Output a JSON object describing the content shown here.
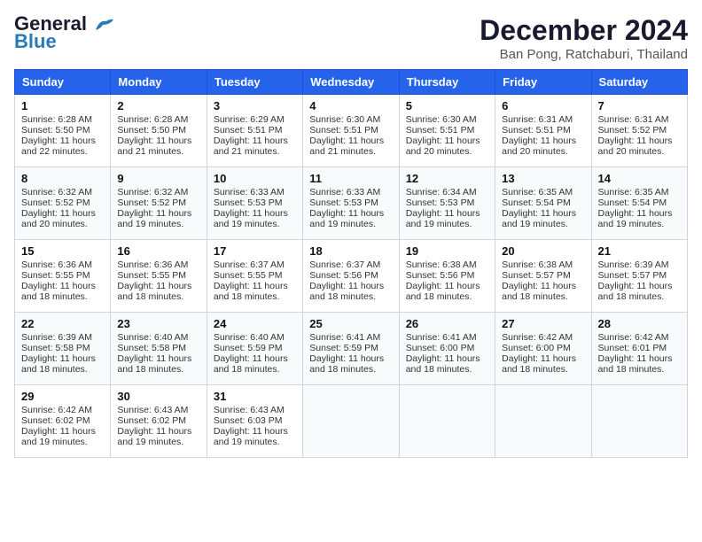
{
  "logo": {
    "line1": "General",
    "line2": "Blue"
  },
  "title": "December 2024",
  "subtitle": "Ban Pong, Ratchaburi, Thailand",
  "weekdays": [
    "Sunday",
    "Monday",
    "Tuesday",
    "Wednesday",
    "Thursday",
    "Friday",
    "Saturday"
  ],
  "weeks": [
    [
      {
        "day": 1,
        "lines": [
          "Sunrise: 6:28 AM",
          "Sunset: 5:50 PM",
          "Daylight: 11 hours",
          "and 22 minutes."
        ]
      },
      {
        "day": 2,
        "lines": [
          "Sunrise: 6:28 AM",
          "Sunset: 5:50 PM",
          "Daylight: 11 hours",
          "and 21 minutes."
        ]
      },
      {
        "day": 3,
        "lines": [
          "Sunrise: 6:29 AM",
          "Sunset: 5:51 PM",
          "Daylight: 11 hours",
          "and 21 minutes."
        ]
      },
      {
        "day": 4,
        "lines": [
          "Sunrise: 6:30 AM",
          "Sunset: 5:51 PM",
          "Daylight: 11 hours",
          "and 21 minutes."
        ]
      },
      {
        "day": 5,
        "lines": [
          "Sunrise: 6:30 AM",
          "Sunset: 5:51 PM",
          "Daylight: 11 hours",
          "and 20 minutes."
        ]
      },
      {
        "day": 6,
        "lines": [
          "Sunrise: 6:31 AM",
          "Sunset: 5:51 PM",
          "Daylight: 11 hours",
          "and 20 minutes."
        ]
      },
      {
        "day": 7,
        "lines": [
          "Sunrise: 6:31 AM",
          "Sunset: 5:52 PM",
          "Daylight: 11 hours",
          "and 20 minutes."
        ]
      }
    ],
    [
      {
        "day": 8,
        "lines": [
          "Sunrise: 6:32 AM",
          "Sunset: 5:52 PM",
          "Daylight: 11 hours",
          "and 20 minutes."
        ]
      },
      {
        "day": 9,
        "lines": [
          "Sunrise: 6:32 AM",
          "Sunset: 5:52 PM",
          "Daylight: 11 hours",
          "and 19 minutes."
        ]
      },
      {
        "day": 10,
        "lines": [
          "Sunrise: 6:33 AM",
          "Sunset: 5:53 PM",
          "Daylight: 11 hours",
          "and 19 minutes."
        ]
      },
      {
        "day": 11,
        "lines": [
          "Sunrise: 6:33 AM",
          "Sunset: 5:53 PM",
          "Daylight: 11 hours",
          "and 19 minutes."
        ]
      },
      {
        "day": 12,
        "lines": [
          "Sunrise: 6:34 AM",
          "Sunset: 5:53 PM",
          "Daylight: 11 hours",
          "and 19 minutes."
        ]
      },
      {
        "day": 13,
        "lines": [
          "Sunrise: 6:35 AM",
          "Sunset: 5:54 PM",
          "Daylight: 11 hours",
          "and 19 minutes."
        ]
      },
      {
        "day": 14,
        "lines": [
          "Sunrise: 6:35 AM",
          "Sunset: 5:54 PM",
          "Daylight: 11 hours",
          "and 19 minutes."
        ]
      }
    ],
    [
      {
        "day": 15,
        "lines": [
          "Sunrise: 6:36 AM",
          "Sunset: 5:55 PM",
          "Daylight: 11 hours",
          "and 18 minutes."
        ]
      },
      {
        "day": 16,
        "lines": [
          "Sunrise: 6:36 AM",
          "Sunset: 5:55 PM",
          "Daylight: 11 hours",
          "and 18 minutes."
        ]
      },
      {
        "day": 17,
        "lines": [
          "Sunrise: 6:37 AM",
          "Sunset: 5:55 PM",
          "Daylight: 11 hours",
          "and 18 minutes."
        ]
      },
      {
        "day": 18,
        "lines": [
          "Sunrise: 6:37 AM",
          "Sunset: 5:56 PM",
          "Daylight: 11 hours",
          "and 18 minutes."
        ]
      },
      {
        "day": 19,
        "lines": [
          "Sunrise: 6:38 AM",
          "Sunset: 5:56 PM",
          "Daylight: 11 hours",
          "and 18 minutes."
        ]
      },
      {
        "day": 20,
        "lines": [
          "Sunrise: 6:38 AM",
          "Sunset: 5:57 PM",
          "Daylight: 11 hours",
          "and 18 minutes."
        ]
      },
      {
        "day": 21,
        "lines": [
          "Sunrise: 6:39 AM",
          "Sunset: 5:57 PM",
          "Daylight: 11 hours",
          "and 18 minutes."
        ]
      }
    ],
    [
      {
        "day": 22,
        "lines": [
          "Sunrise: 6:39 AM",
          "Sunset: 5:58 PM",
          "Daylight: 11 hours",
          "and 18 minutes."
        ]
      },
      {
        "day": 23,
        "lines": [
          "Sunrise: 6:40 AM",
          "Sunset: 5:58 PM",
          "Daylight: 11 hours",
          "and 18 minutes."
        ]
      },
      {
        "day": 24,
        "lines": [
          "Sunrise: 6:40 AM",
          "Sunset: 5:59 PM",
          "Daylight: 11 hours",
          "and 18 minutes."
        ]
      },
      {
        "day": 25,
        "lines": [
          "Sunrise: 6:41 AM",
          "Sunset: 5:59 PM",
          "Daylight: 11 hours",
          "and 18 minutes."
        ]
      },
      {
        "day": 26,
        "lines": [
          "Sunrise: 6:41 AM",
          "Sunset: 6:00 PM",
          "Daylight: 11 hours",
          "and 18 minutes."
        ]
      },
      {
        "day": 27,
        "lines": [
          "Sunrise: 6:42 AM",
          "Sunset: 6:00 PM",
          "Daylight: 11 hours",
          "and 18 minutes."
        ]
      },
      {
        "day": 28,
        "lines": [
          "Sunrise: 6:42 AM",
          "Sunset: 6:01 PM",
          "Daylight: 11 hours",
          "and 18 minutes."
        ]
      }
    ],
    [
      {
        "day": 29,
        "lines": [
          "Sunrise: 6:42 AM",
          "Sunset: 6:02 PM",
          "Daylight: 11 hours",
          "and 19 minutes."
        ]
      },
      {
        "day": 30,
        "lines": [
          "Sunrise: 6:43 AM",
          "Sunset: 6:02 PM",
          "Daylight: 11 hours",
          "and 19 minutes."
        ]
      },
      {
        "day": 31,
        "lines": [
          "Sunrise: 6:43 AM",
          "Sunset: 6:03 PM",
          "Daylight: 11 hours",
          "and 19 minutes."
        ]
      },
      null,
      null,
      null,
      null
    ]
  ]
}
